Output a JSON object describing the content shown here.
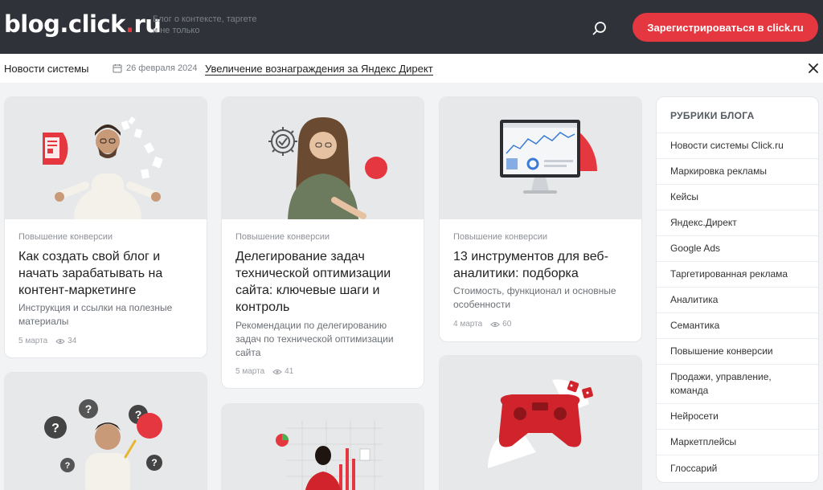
{
  "header": {
    "logo_main": "blog.click",
    "logo_dot": ".",
    "logo_suffix": "ru",
    "tagline": "Блог о контексте, таргете и не только",
    "register_label": "Зарегистрироваться в click.ru"
  },
  "newsbar": {
    "label": "Новости системы",
    "date": "26 февраля 2024",
    "headline": "Увеличение вознаграждения за Яндекс Директ"
  },
  "cards": [
    {
      "category": "Повышение конверсии",
      "title": "Как создать свой блог и начать зарабатывать на контент-маркетинге",
      "description": "Инструкция и ссылки на полезные материалы",
      "date": "5 марта",
      "views": "34"
    },
    {
      "category": "Повышение конверсии",
      "title": "Делегирование задач технической оптимизации сайта: ключевые шаги и контроль",
      "description": "Рекомендации по делегированию задач по технической оптимизации сайта",
      "date": "5 марта",
      "views": "41"
    },
    {
      "category": "Повышение конверсии",
      "title": "13 инструментов для веб-аналитики: подборка",
      "description": "Стоимость, функционал и основные особенности",
      "date": "4 марта",
      "views": "60"
    }
  ],
  "sidebar": {
    "title": "РУБРИКИ БЛОГА",
    "items": [
      "Новости системы Click.ru",
      "Маркировка рекламы",
      "Кейсы",
      "Яндекс.Директ",
      "Google Ads",
      "Таргетированная реклама",
      "Аналитика",
      "Семантика",
      "Повышение конверсии",
      "Продажи, управление, команда",
      "Нейросети",
      "Маркетплейсы",
      "Глоссарий"
    ]
  },
  "colors": {
    "header_bg": "#2f3238",
    "accent": "#e53740",
    "page_bg": "#f2f3f5"
  },
  "icons": {
    "search": "search-icon",
    "calendar": "calendar-icon",
    "close": "close-icon",
    "views": "eye-icon"
  }
}
